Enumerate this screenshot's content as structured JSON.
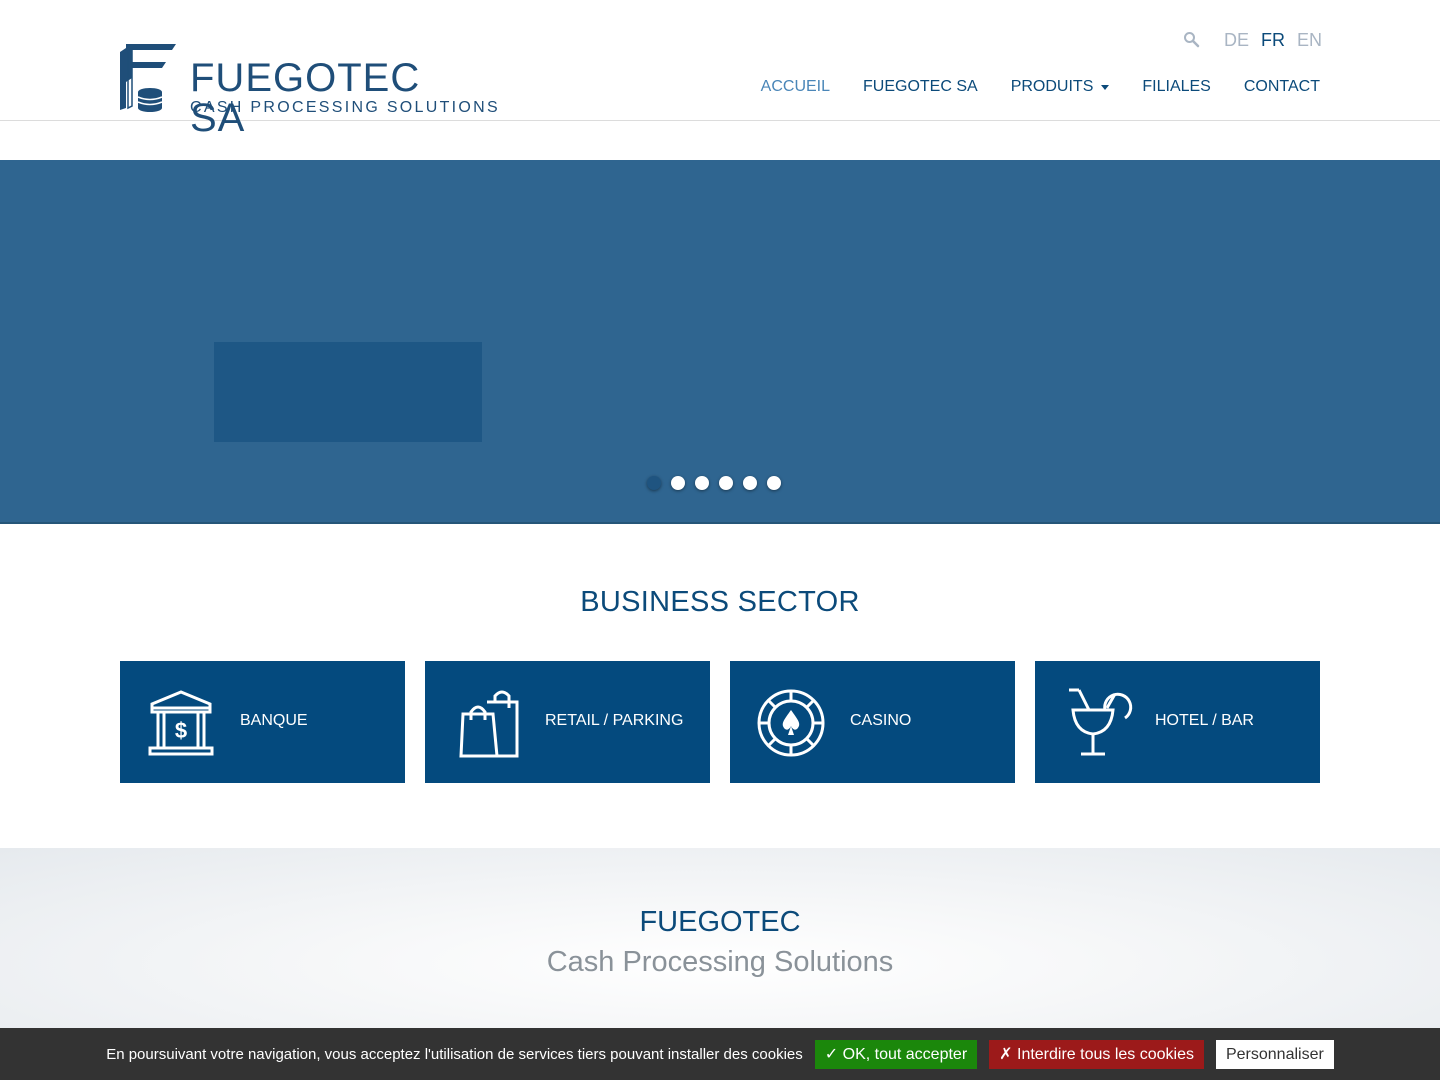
{
  "header": {
    "logo": {
      "name": "FUEGOTEC SA",
      "tagline": "CASH PROCESSING SOLUTIONS"
    },
    "languages": [
      {
        "code": "DE",
        "active": false
      },
      {
        "code": "FR",
        "active": true
      },
      {
        "code": "EN",
        "active": false
      }
    ],
    "nav": [
      {
        "label": "ACCUEIL",
        "active": true
      },
      {
        "label": "FUEGOTEC SA",
        "active": false
      },
      {
        "label": "PRODUITS",
        "active": false,
        "dropdown": true
      },
      {
        "label": "FILIALES",
        "active": false
      },
      {
        "label": "CONTACT",
        "active": false
      }
    ]
  },
  "hero": {
    "background_color": "#2f6590",
    "slides_count": 6,
    "active_slide": 1
  },
  "sector": {
    "title": "BUSINESS SECTOR",
    "cards": [
      {
        "label": "BANQUE",
        "icon": "bank-icon"
      },
      {
        "label": "RETAIL / PARKING",
        "icon": "shopping-bag-icon"
      },
      {
        "label": "CASINO",
        "icon": "casino-chip-icon"
      },
      {
        "label": "HOTEL / BAR",
        "icon": "cocktail-icon"
      }
    ]
  },
  "about": {
    "title": "FUEGOTEC",
    "subtitle": "Cash Processing Solutions"
  },
  "cookie": {
    "text": "En poursuivant votre navigation, vous acceptez l'utilisation de services tiers pouvant installer des cookies",
    "accept": "✓ OK, tout accepter",
    "deny": "✗ Interdire tous les cookies",
    "customize": "Personnaliser"
  },
  "colors": {
    "brand": "#0b4a7a",
    "card": "#044a7e",
    "accept": "#1b870b",
    "deny": "#9c1a1a"
  }
}
